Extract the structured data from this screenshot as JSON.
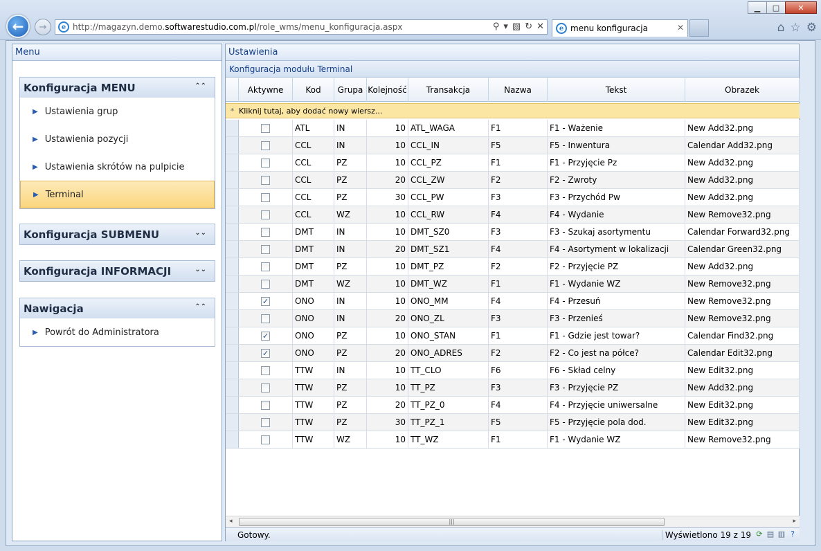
{
  "browser": {
    "url_prefix": "http://magazyn.demo.",
    "url_domain": "softwarestudio.com.pl",
    "url_path": "/role_wms/menu_konfiguracja.aspx",
    "tab_title": "menu konfiguracja"
  },
  "left_panel": {
    "title": "Menu",
    "groups": [
      {
        "title": "Konfiguracja MENU",
        "chevron": "⌃⌃",
        "items": [
          "Ustawienia grup",
          "Ustawienia pozycji",
          "Ustawienia skrótów na pulpicie",
          "Terminal"
        ],
        "selected": "Terminal"
      },
      {
        "title": "Konfiguracja SUBMENU",
        "chevron": "⌄⌄"
      },
      {
        "title": "Konfiguracja INFORMACJI",
        "chevron": "⌄⌄"
      },
      {
        "title": "Nawigacja",
        "chevron": "⌃⌃",
        "items": [
          "Powrót do Administratora"
        ]
      }
    ]
  },
  "right_panel": {
    "title": "Ustawienia",
    "caption": "Konfiguracja modułu Terminal",
    "new_row_text": "Kliknij tutaj, aby dodać nowy wiersz...",
    "columns": [
      "Aktywne",
      "Kod",
      "Grupa",
      "Kolejność",
      "Transakcja",
      "Nazwa",
      "Tekst",
      "Obrazek"
    ],
    "rows": [
      {
        "active": false,
        "kod": "ATL",
        "grupa": "IN",
        "kol": "10",
        "trans": "ATL_WAGA",
        "nazwa": "F1",
        "tekst": "F1 - Ważenie",
        "obrazek": "New Add32.png"
      },
      {
        "active": false,
        "kod": "CCL",
        "grupa": "IN",
        "kol": "10",
        "trans": "CCL_IN",
        "nazwa": "F5",
        "tekst": "F5 - Inwentura",
        "obrazek": "Calendar Add32.png"
      },
      {
        "active": false,
        "kod": "CCL",
        "grupa": "PZ",
        "kol": "10",
        "trans": "CCL_PZ",
        "nazwa": "F1",
        "tekst": "F1 - Przyjęcie Pz",
        "obrazek": "New Add32.png"
      },
      {
        "active": false,
        "kod": "CCL",
        "grupa": "PZ",
        "kol": "20",
        "trans": "CCL_ZW",
        "nazwa": "F2",
        "tekst": "F2 - Zwroty",
        "obrazek": "New Add32.png"
      },
      {
        "active": false,
        "kod": "CCL",
        "grupa": "PZ",
        "kol": "30",
        "trans": "CCL_PW",
        "nazwa": "F3",
        "tekst": "F3 - Przychód Pw",
        "obrazek": "New Add32.png"
      },
      {
        "active": false,
        "kod": "CCL",
        "grupa": "WZ",
        "kol": "10",
        "trans": "CCL_RW",
        "nazwa": "F4",
        "tekst": "F4 - Wydanie",
        "obrazek": "New Remove32.png"
      },
      {
        "active": false,
        "kod": "DMT",
        "grupa": "IN",
        "kol": "10",
        "trans": "DMT_SZ0",
        "nazwa": "F3",
        "tekst": "F3 - Szukaj asortymentu",
        "obrazek": "Calendar Forward32.png"
      },
      {
        "active": false,
        "kod": "DMT",
        "grupa": "IN",
        "kol": "20",
        "trans": "DMT_SZ1",
        "nazwa": "F4",
        "tekst": "F4 - Asortyment w lokalizacji",
        "obrazek": "Calendar Green32.png"
      },
      {
        "active": false,
        "kod": "DMT",
        "grupa": "PZ",
        "kol": "10",
        "trans": "DMT_PZ",
        "nazwa": "F2",
        "tekst": "F2 - Przyjęcie PZ",
        "obrazek": "New Add32.png"
      },
      {
        "active": false,
        "kod": "DMT",
        "grupa": "WZ",
        "kol": "10",
        "trans": "DMT_WZ",
        "nazwa": "F1",
        "tekst": "F1 - Wydanie WZ",
        "obrazek": "New Remove32.png"
      },
      {
        "active": true,
        "kod": "ONO",
        "grupa": "IN",
        "kol": "10",
        "trans": "ONO_MM",
        "nazwa": "F4",
        "tekst": "F4 - Przesuń",
        "obrazek": "New Remove32.png"
      },
      {
        "active": false,
        "kod": "ONO",
        "grupa": "IN",
        "kol": "20",
        "trans": "ONO_ZL",
        "nazwa": "F3",
        "tekst": "F3 - Przenieś",
        "obrazek": "New Remove32.png"
      },
      {
        "active": true,
        "kod": "ONO",
        "grupa": "PZ",
        "kol": "10",
        "trans": "ONO_STAN",
        "nazwa": "F1",
        "tekst": "F1 - Gdzie jest towar?",
        "obrazek": "Calendar Find32.png"
      },
      {
        "active": true,
        "kod": "ONO",
        "grupa": "PZ",
        "kol": "20",
        "trans": "ONO_ADRES",
        "nazwa": "F2",
        "tekst": "F2 - Co jest na półce?",
        "obrazek": "Calendar Edit32.png"
      },
      {
        "active": false,
        "kod": "TTW",
        "grupa": "IN",
        "kol": "10",
        "trans": "TT_CLO",
        "nazwa": "F6",
        "tekst": "F6 - Skład celny",
        "obrazek": "New Edit32.png"
      },
      {
        "active": false,
        "kod": "TTW",
        "grupa": "PZ",
        "kol": "10",
        "trans": "TT_PZ",
        "nazwa": "F3",
        "tekst": "F3 - Przyjęcie PZ",
        "obrazek": "New Add32.png"
      },
      {
        "active": false,
        "kod": "TTW",
        "grupa": "PZ",
        "kol": "20",
        "trans": "TT_PZ_0",
        "nazwa": "F4",
        "tekst": "F4 - Przyjęcie uniwersalne",
        "obrazek": "New Edit32.png"
      },
      {
        "active": false,
        "kod": "TTW",
        "grupa": "PZ",
        "kol": "30",
        "trans": "TT_PZ_1",
        "nazwa": "F5",
        "tekst": "F5 - Przyjęcie pola dod.",
        "obrazek": "New Edit32.png"
      },
      {
        "active": false,
        "kod": "TTW",
        "grupa": "WZ",
        "kol": "10",
        "trans": "TT_WZ",
        "nazwa": "F1",
        "tekst": "F1 - Wydanie WZ",
        "obrazek": "New Remove32.png"
      }
    ],
    "status": "Gotowy.",
    "count": "Wyświetlono 19 z 19"
  }
}
